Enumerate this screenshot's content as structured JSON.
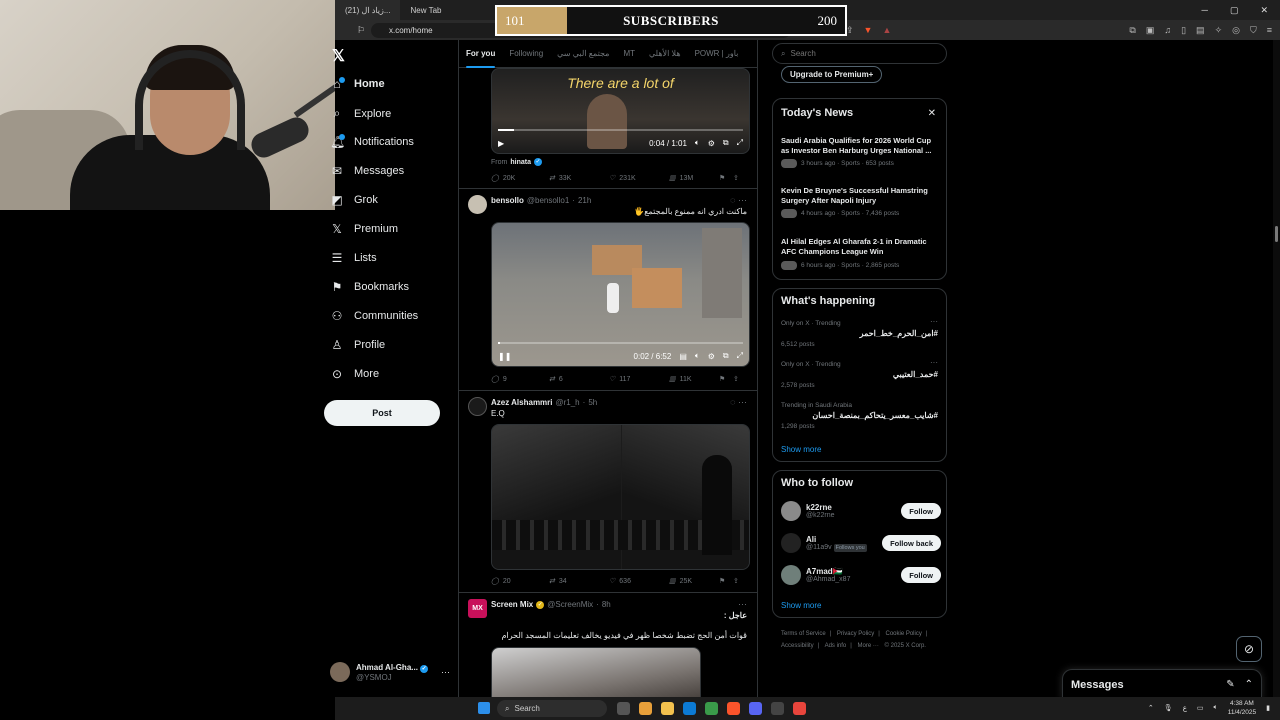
{
  "browser": {
    "tabs": [
      "(21) زياد ال...",
      "New Tab"
    ],
    "url": "x.com/home",
    "window_controls": [
      "─",
      "▢",
      "✕"
    ]
  },
  "subscribers": {
    "min": "101",
    "label": "SUBSCRIBERS",
    "max": "200",
    "fill_fraction": 0.2
  },
  "nav": {
    "items": [
      {
        "label": "Home",
        "icon": "home-icon"
      },
      {
        "label": "Explore",
        "icon": "search-icon"
      },
      {
        "label": "Notifications",
        "icon": "bell-icon"
      },
      {
        "label": "Messages",
        "icon": "mail-icon"
      },
      {
        "label": "Grok",
        "icon": "grok-icon"
      },
      {
        "label": "Premium",
        "icon": "x-icon"
      },
      {
        "label": "Lists",
        "icon": "list-icon"
      },
      {
        "label": "Bookmarks",
        "icon": "bookmark-icon"
      },
      {
        "label": "Communities",
        "icon": "people-icon"
      },
      {
        "label": "Profile",
        "icon": "person-icon"
      },
      {
        "label": "More",
        "icon": "more-circle-icon"
      }
    ],
    "post_label": "Post",
    "account": {
      "name": "Ahmad Al-Gha...",
      "handle": "@YSMOJ"
    }
  },
  "timeline": {
    "tabs": [
      "For you",
      "Following",
      "مجتمع البي سي",
      "MT",
      "هلا الأهلي",
      "POWR | باور"
    ],
    "tweet1": {
      "caption": "There are a lot of",
      "time": "0:04 / 1:01",
      "progress": 0.065,
      "from_label": "From",
      "from_name": "hinata",
      "replies": "20K",
      "reposts": "33K",
      "likes": "231K",
      "views": "13M"
    },
    "tweet2": {
      "name": "bensollo",
      "handle": "@bensollo1",
      "time": "21h",
      "text": "ماكنت ادري انه ممنوع بالمجتمع🖐",
      "video_time": "0:02 / 6:52",
      "progress": 0.005,
      "replies": "9",
      "reposts": "6",
      "likes": "117",
      "views": "11K"
    },
    "tweet3": {
      "name": "Azez Alshammri",
      "handle": "@r1_h",
      "time": "5h",
      "text": "E.Q",
      "replies": "20",
      "reposts": "34",
      "likes": "636",
      "views": "25K"
    },
    "tweet4": {
      "name": "Screen Mix",
      "handle": "@ScreenMix",
      "time": "8h",
      "avatar_text": "MX",
      "line1": "عاجل :",
      "line2": "قوات أمن الحج تضبط شخصا ظهر في فيديو يخالف تعليمات المسجد الحرام"
    }
  },
  "right": {
    "search_placeholder": "Search",
    "premium_label": "Upgrade to Premium+",
    "news": {
      "title": "Today's News",
      "items": [
        {
          "title": "Saudi Arabia Qualifies for 2026 World Cup as Investor Ben Harburg Urges National ...",
          "meta": "3 hours ago · Sports · 653 posts"
        },
        {
          "title": "Kevin De Bruyne's Successful Hamstring Surgery After Napoli Injury",
          "meta": "4 hours ago · Sports · 7,436 posts"
        },
        {
          "title": "Al Hilal Edges Al Gharafa 2-1 in Dramatic AFC Champions League Win",
          "meta": "6 hours ago · Sports · 2,865 posts"
        }
      ]
    },
    "happening": {
      "title": "What's happening",
      "items": [
        {
          "context": "Only on X · Trending",
          "name": "#امن_الحرم_خط_احمر",
          "count": "6,512 posts"
        },
        {
          "context": "Only on X · Trending",
          "name": "#حمد_العتيبي",
          "count": "2,578 posts"
        },
        {
          "context": "Trending in Saudi Arabia",
          "name": "#شايب_معسر_يتحاكم_بمنصة_احسان",
          "count": "1,298 posts"
        }
      ],
      "show_more": "Show more"
    },
    "follow": {
      "title": "Who to follow",
      "items": [
        {
          "name": "k22rne",
          "handle": "@k22rne",
          "button": "Follow",
          "follows_you": ""
        },
        {
          "name": "Ali",
          "handle": "@11a9v",
          "button": "Follow back",
          "follows_you": "Follows you"
        },
        {
          "name": "A7mad🇯🇴",
          "handle": "@Ahmad_x87",
          "button": "Follow",
          "follows_you": ""
        }
      ],
      "show_more": "Show more"
    },
    "footer": [
      "Terms of Service",
      "|",
      "Privacy Policy",
      "|",
      "Cookie Policy",
      "|",
      "Accessibility",
      "|",
      "Ads info",
      "|",
      "More ···",
      "© 2025 X Corp."
    ]
  },
  "messages": {
    "label": "Messages"
  },
  "taskbar": {
    "search": "Search",
    "time": "4:38 AM",
    "date": "11/4/2025",
    "lang": "ع"
  }
}
